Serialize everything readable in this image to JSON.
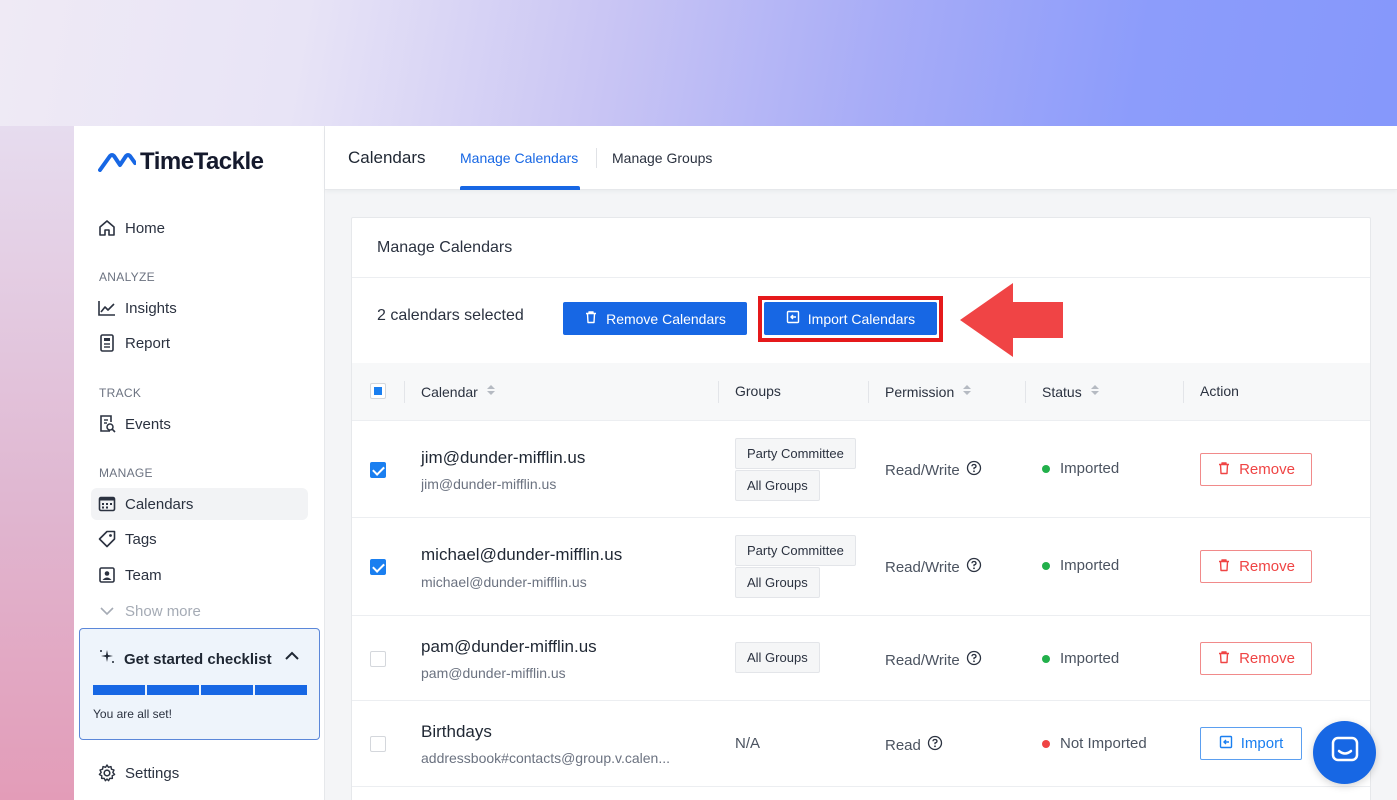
{
  "app": {
    "logo_text": "TimeTackle",
    "accent_color": "#1767e4"
  },
  "sidebar": {
    "home": "Home",
    "sections": {
      "analyze": "ANALYZE",
      "track": "TRACK",
      "manage": "MANAGE"
    },
    "items": {
      "insights": "Insights",
      "report": "Report",
      "events": "Events",
      "calendars": "Calendars",
      "tags": "Tags",
      "team": "Team",
      "show_more": "Show more",
      "settings": "Settings"
    },
    "checklist": {
      "title": "Get started checklist",
      "message": "You are all set!",
      "progress_steps_done": 4,
      "progress_steps_total": 4
    }
  },
  "topbar": {
    "title": "Calendars",
    "tabs": [
      {
        "label": "Manage Calendars",
        "active": true
      },
      {
        "label": "Manage Groups",
        "active": false
      }
    ]
  },
  "card": {
    "title": "Manage Calendars",
    "selected_text": "2 calendars selected",
    "remove_calendars_label": "Remove Calendars",
    "import_calendars_label": "Import Calendars"
  },
  "table": {
    "columns": {
      "calendar": "Calendar",
      "groups": "Groups",
      "permission": "Permission",
      "status": "Status",
      "action": "Action"
    },
    "rows": [
      {
        "name": "jim@dunder-mifflin.us",
        "sub": "jim@dunder-mifflin.us",
        "groups": [
          "Party Committee",
          "All Groups"
        ],
        "permission": "Read/Write",
        "status": "Imported",
        "action": "Remove",
        "checked": true
      },
      {
        "name": "michael@dunder-mifflin.us",
        "sub": "michael@dunder-mifflin.us",
        "groups": [
          "Party Committee",
          "All Groups"
        ],
        "permission": "Read/Write",
        "status": "Imported",
        "action": "Remove",
        "checked": true
      },
      {
        "name": "pam@dunder-mifflin.us",
        "sub": "pam@dunder-mifflin.us",
        "groups": [
          "All Groups"
        ],
        "permission": "Read/Write",
        "status": "Imported",
        "action": "Remove",
        "checked": false
      },
      {
        "name": "Birthdays",
        "sub": "addressbook#contacts@group.v.calen...",
        "groups_text": "N/A",
        "permission": "Read",
        "status": "Not Imported",
        "action": "Import",
        "checked": false
      }
    ]
  },
  "colors": {
    "status_imported": "#22b04b",
    "status_not_imported": "#ef4444",
    "highlight": "#e5191b",
    "arrow": "#f04445"
  }
}
